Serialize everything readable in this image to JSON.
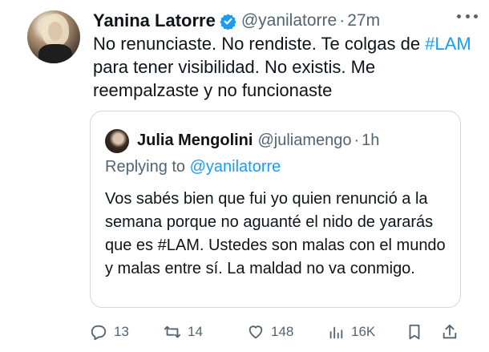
{
  "tweet": {
    "author_name": "Yanina Latorre",
    "author_handle": "@yanilatorre",
    "separator": "·",
    "time": "27m",
    "text_part1": "No renunciaste. No rendiste. Te colgas de ",
    "hashtag": "#LAM",
    "text_part2": " para tener visibilidad. No existis. Me reempalzaste y no funcionaste"
  },
  "quote": {
    "author_name": "Julia Mengolini",
    "author_handle": "@juliamengo",
    "separator": "·",
    "time": "1h",
    "replying_prefix": "Replying to ",
    "replying_handle": "@yanilatorre",
    "text_part1": "Vos sabés bien que fui yo quien renunció a la semana porque no aguanté el nido de yararás que es ",
    "text_part2": "#LAM. Ustedes son malas con el mundo y malas entre sí. La maldad no va conmigo."
  },
  "actions": {
    "replies": "13",
    "reposts": "14",
    "likes": "148",
    "views": "16K"
  },
  "colors": {
    "accent": "#1d9bf0",
    "secondary_text": "#536471",
    "border": "#cfd9de"
  },
  "icons": [
    "verified-badge-icon",
    "more-icon",
    "reply-icon",
    "repost-icon",
    "like-icon",
    "views-icon",
    "bookmark-icon",
    "share-icon"
  ]
}
